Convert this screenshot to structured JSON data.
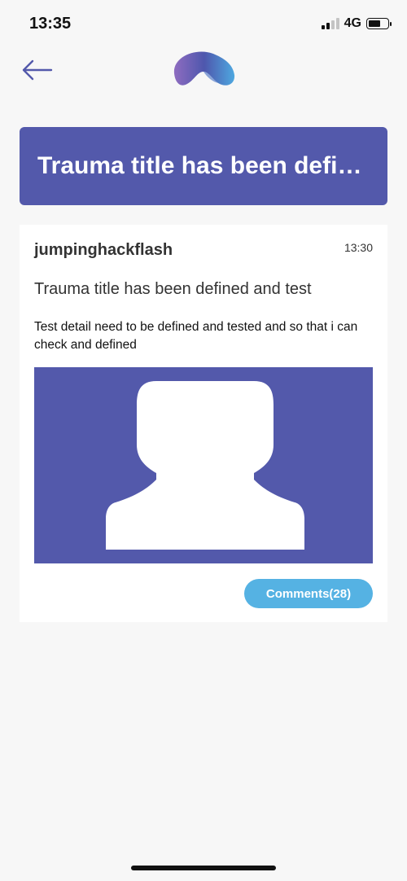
{
  "status_bar": {
    "time": "13:35",
    "network": "4G",
    "battery_level": 0.62
  },
  "header": {
    "back_icon": "arrow-left-icon",
    "logo_icon": "app-logo-icon"
  },
  "banner": {
    "title": "Trauma title has been defined and test"
  },
  "post": {
    "username": "jumpinghackflash",
    "time": "13:30",
    "title": "Trauma title has been defined and test",
    "detail": "Test detail need to be defined and tested and so that i can check and defined",
    "image_icon": "user-placeholder-icon",
    "comments_label": "Comments(28)"
  },
  "colors": {
    "accent": "#5359ab",
    "comments_button": "#55b2e3",
    "background": "#f7f7f7"
  }
}
